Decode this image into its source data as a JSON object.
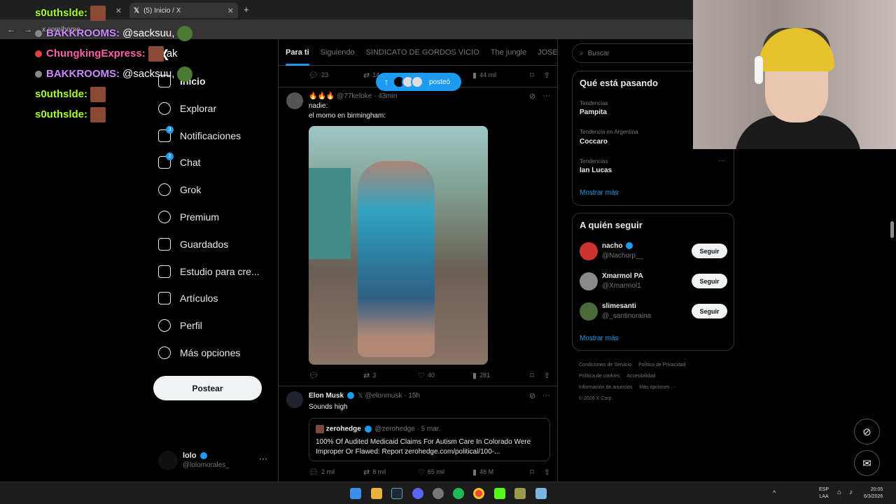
{
  "browser": {
    "tabs": [
      {
        "title": "",
        "active": false
      },
      {
        "title": "(5) Inicio / X",
        "active": true
      }
    ],
    "new_tab": "+",
    "url": "x.com/home"
  },
  "chat_overlay": [
    {
      "user": "s0uthslde:",
      "msg": "",
      "color": "green"
    },
    {
      "user": "BAKKROOMS:",
      "msg": "@sacksuu,",
      "color": "purple"
    },
    {
      "user": "ChungkingExpress:",
      "msg": "ak",
      "color": "pink"
    },
    {
      "user": "BAKKROOMS:",
      "msg": "@sacksuu,",
      "color": "purple"
    },
    {
      "user": "s0uthslde:",
      "msg": "",
      "color": "green"
    },
    {
      "user": "s0uthslde:",
      "msg": "",
      "color": "green"
    }
  ],
  "nav": {
    "logo": "X",
    "items": [
      {
        "label": "Inicio",
        "icon": "home-icon",
        "badge": ""
      },
      {
        "label": "Explorar",
        "icon": "search-icon",
        "badge": ""
      },
      {
        "label": "Notificaciones",
        "icon": "bell-icon",
        "badge": "3"
      },
      {
        "label": "Chat",
        "icon": "mail-icon",
        "badge": "2"
      },
      {
        "label": "Grok",
        "icon": "grok-icon",
        "badge": ""
      },
      {
        "label": "Premium",
        "icon": "verified-icon",
        "badge": ""
      },
      {
        "label": "Guardados",
        "icon": "bookmark-icon",
        "badge": ""
      },
      {
        "label": "Estudio para cre...",
        "icon": "creator-studio-icon",
        "badge": ""
      },
      {
        "label": "Artículos",
        "icon": "articles-icon",
        "badge": ""
      },
      {
        "label": "Perfil",
        "icon": "person-icon",
        "badge": ""
      },
      {
        "label": "Más opciones",
        "icon": "more-circle-icon",
        "badge": ""
      }
    ],
    "post_button": "Postear",
    "account": {
      "name": "lolo",
      "handle": "@lolomorales_",
      "more": "···"
    }
  },
  "timeline": {
    "tabs": [
      "Para ti",
      "Siguiendo",
      "SINDICATO DE GORDOS VICIO",
      "The jungle",
      "JOSEO"
    ],
    "top_actions": {
      "replies": "23",
      "reposts": "14",
      "likes": "",
      "views": "44 mil"
    },
    "new_posts_pill": "posteó",
    "post1": {
      "name": "🔥🔥🔥",
      "handle": "@77keloke",
      "time": "· 43min",
      "text": [
        "nadie:",
        "el momo en birmingham:"
      ],
      "actions": {
        "replies": "",
        "reposts": "3",
        "likes": "40",
        "views": "281"
      }
    },
    "post2": {
      "name": "Elon Musk",
      "handle": "@elonmusk",
      "time": "· 15h",
      "text": "Sounds high",
      "quote": {
        "name": "zerohedge",
        "handle": "@zerohedge",
        "time": "· 5 mar.",
        "text": "100% Of Audited Medicaid Claims For Autism Care In Colorado Were Improper Or Flawed: Report zerohedge.com/political/100-..."
      },
      "actions": {
        "replies": "2 mil",
        "reposts": "8 mil",
        "likes": "65 mil",
        "views": "46 M"
      }
    }
  },
  "sidebar": {
    "search_placeholder": "Buscar",
    "trends_title": "Qué está pasando",
    "trends": [
      {
        "context": "Tendencias",
        "name": "Pampita"
      },
      {
        "context": "Tendencia en Argentina",
        "name": "Coccaro"
      },
      {
        "context": "Tendencias",
        "name": "Ian Lucas"
      }
    ],
    "show_more": "Mostrar más",
    "who_title": "A quién seguir",
    "who": [
      {
        "name": "nacho",
        "handle": "@Nachorp__",
        "button": "Seguir"
      },
      {
        "name": "Xmarmol PA",
        "handle": "@Xmarmol1",
        "button": "Seguir"
      },
      {
        "name": "slimesanti",
        "handle": "@_santinoraina",
        "button": "Seguir"
      }
    ],
    "footer": [
      "Condiciones de Servicio",
      "Política de Privacidad",
      "Política de cookies",
      "Accesibilidad",
      "Información de anuncios",
      "Más opciones ···",
      "© 2026 X Corp."
    ]
  },
  "taskbar": {
    "lang_top": "ESP",
    "lang_bottom": "LAA",
    "time": "20:05",
    "date": "6/3/2026"
  }
}
